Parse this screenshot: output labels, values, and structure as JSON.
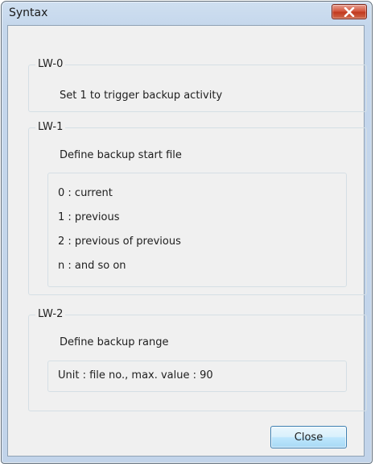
{
  "dialog": {
    "title": "Syntax",
    "close_button_label": "Close"
  },
  "groups": [
    {
      "legend": "LW-0",
      "description": "Set 1 to trigger backup activity"
    },
    {
      "legend": "LW-1",
      "description": "Define backup start file",
      "options": [
        "0 : current",
        "1 : previous",
        "2 : previous of previous",
        "n : and so on"
      ]
    },
    {
      "legend": "LW-2",
      "description": "Define backup range",
      "note": "Unit : file no., max. value : 90"
    }
  ],
  "colors": {
    "titlebar": "#c5d7ec",
    "close_x_button": "#c94a30",
    "client_bg": "#f0f0f0"
  },
  "icons": {
    "close_x": "close-icon"
  }
}
